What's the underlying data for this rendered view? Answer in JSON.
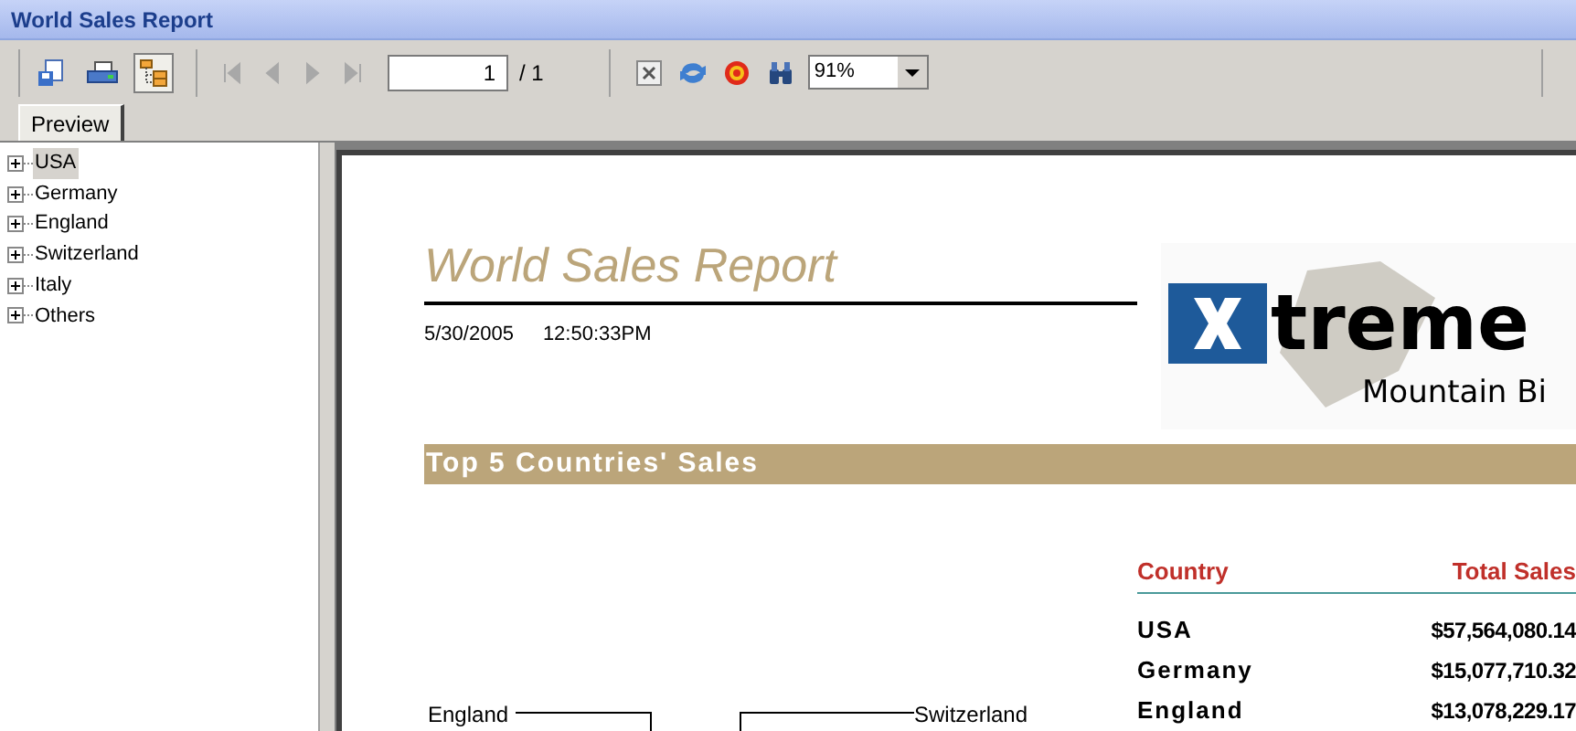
{
  "window": {
    "title": "World Sales Report"
  },
  "toolbar": {
    "export_tree_pressed": true,
    "navigation_disabled": true,
    "page": "1",
    "page_total": "/ 1",
    "zoom": "91%"
  },
  "tabs": [
    {
      "label": "Preview",
      "selected": true
    }
  ],
  "tree": {
    "items": [
      {
        "label": "USA",
        "selected": true,
        "expanded": false
      },
      {
        "label": "Germany",
        "selected": false,
        "expanded": false
      },
      {
        "label": "England",
        "selected": false,
        "expanded": false
      },
      {
        "label": "Switzerland",
        "selected": false,
        "expanded": false
      },
      {
        "label": "Italy",
        "selected": false,
        "expanded": false
      },
      {
        "label": "Others",
        "selected": false,
        "expanded": false
      }
    ]
  },
  "report": {
    "title": "World Sales Report",
    "date": "5/30/2005",
    "time": "12:50:33PM",
    "logo_text": "treme",
    "logo_subtext": "Mountain Bi",
    "section_title": "Top 5 Countries' Sales",
    "chart_labels": [
      "England",
      "Switzerland"
    ],
    "table": {
      "columns": [
        "Country",
        "Total Sales"
      ],
      "rows": [
        [
          "USA",
          "$57,564,080.14"
        ],
        [
          "Germany",
          "$15,077,710.32"
        ],
        [
          "England",
          "$13,078,229.17"
        ]
      ]
    }
  }
}
